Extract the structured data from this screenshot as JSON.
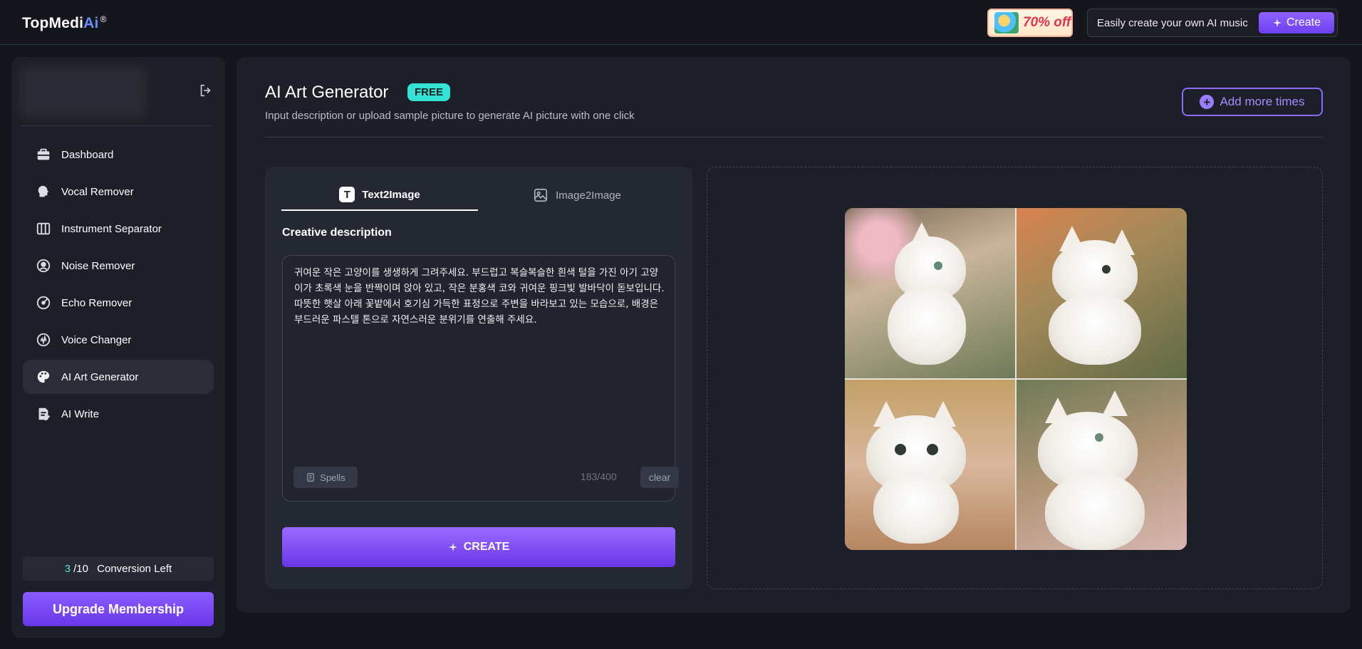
{
  "header": {
    "logo_prefix": "TopMedi",
    "logo_ai": "Ai",
    "logo_reg": "®",
    "promo_text": "70% off",
    "music_text": "Easily create your own AI music",
    "music_create_label": "Create"
  },
  "sidebar": {
    "items": [
      {
        "label": "Dashboard",
        "icon": "briefcase-icon"
      },
      {
        "label": "Vocal Remover",
        "icon": "head-voice-icon"
      },
      {
        "label": "Instrument Separator",
        "icon": "piano-keys-icon"
      },
      {
        "label": "Noise Remover",
        "icon": "noise-icon"
      },
      {
        "label": "Echo Remover",
        "icon": "echo-icon"
      },
      {
        "label": "Voice Changer",
        "icon": "voice-changer-icon"
      },
      {
        "label": "AI Art Generator",
        "icon": "palette-icon"
      },
      {
        "label": "AI Write",
        "icon": "write-icon"
      }
    ],
    "active_item": "AI Art Generator",
    "conversion_used": "3",
    "conversion_total": "/10",
    "conversion_label": "Conversion Left",
    "upgrade_label": "Upgrade Membership"
  },
  "main": {
    "title": "AI Art Generator",
    "badge": "FREE",
    "subtitle": "Input description or upload sample picture to generate AI picture with one click",
    "add_more_label": "Add more times",
    "tabs": [
      {
        "label": "Text2Image",
        "active": true
      },
      {
        "label": "Image2Image",
        "active": false
      }
    ],
    "section_label": "Creative description",
    "prompt_text": "귀여운 작은 고양이를 생생하게 그려주세요. 부드럽고 복슬복슬한 흰색 털을 가진 아기 고양이가 초록색 눈을 반짝이며 앉아 있고, 작은 분홍색 코와 귀여운 핑크빛 발바닥이 돋보입니다. 따뜻한 햇살 아래 꽃밭에서 호기심 가득한 표정으로 주변을 바라보고 있는 모습으로, 배경은 부드러운 파스텔 톤으로 자연스러운 분위기를 연출해 주세요.",
    "spells_label": "Spells",
    "counter": "183/400",
    "clear_label": "clear",
    "create_label": "CREATE"
  },
  "colors": {
    "accent": "#7c4dff",
    "badge": "#34e3d4",
    "background": "#14151c",
    "panel": "#1d1f28"
  }
}
